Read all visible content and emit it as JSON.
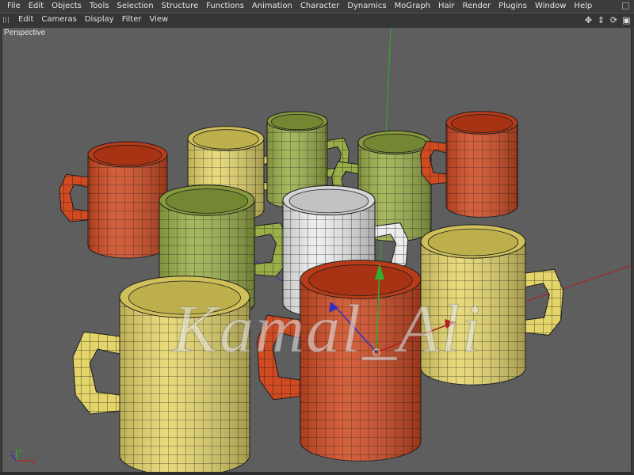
{
  "menu": {
    "items": [
      "File",
      "Edit",
      "Objects",
      "Tools",
      "Selection",
      "Structure",
      "Functions",
      "Animation",
      "Character",
      "Dynamics",
      "MoGraph",
      "Hair",
      "Render",
      "Plugins",
      "Window",
      "Help"
    ]
  },
  "view_menu": {
    "items": [
      "Edit",
      "Cameras",
      "Display",
      "Filter",
      "View"
    ],
    "nav_icons": [
      "move-view-icon",
      "zoom-view-icon",
      "rotate-view-icon",
      "maximize-view-icon"
    ]
  },
  "viewport": {
    "label": "Perspective",
    "watermark": "Kamal_Ali",
    "axis_letters": [
      "Z",
      "Y",
      "X"
    ]
  },
  "colors": {
    "viewport_bg": "#5e5e5e",
    "mug_red": "#d04a22",
    "mug_yellow": "#e4d56b",
    "mug_green": "#9aae4a",
    "mug_white": "#ececec",
    "axis_red": "#b02020",
    "axis_green": "#2fb02f",
    "axis_blue": "#3030c0"
  },
  "scene": {
    "objects": [
      {
        "name": "mug-back-yellow",
        "color": "yellow"
      },
      {
        "name": "mug-back-green",
        "color": "green"
      },
      {
        "name": "mug-back-green-right",
        "color": "green"
      },
      {
        "name": "mug-back-red-right",
        "color": "red"
      },
      {
        "name": "mug-red-left",
        "color": "red"
      },
      {
        "name": "mug-green-left",
        "color": "green"
      },
      {
        "name": "mug-white",
        "color": "white"
      },
      {
        "name": "mug-yellow-right",
        "color": "yellow"
      },
      {
        "name": "mug-yellow-front",
        "color": "yellow"
      },
      {
        "name": "mug-red-front",
        "color": "red"
      }
    ]
  }
}
